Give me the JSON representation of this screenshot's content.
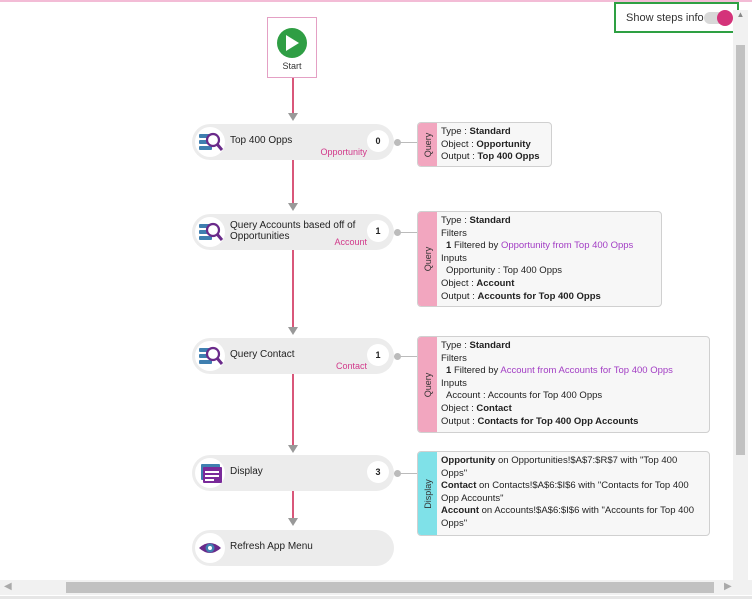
{
  "toggle": {
    "label": "Show steps info",
    "on": true
  },
  "start": {
    "label": "Start"
  },
  "steps": [
    {
      "title": "Top 400 Opps",
      "subtitle": "Opportunity",
      "count": "0",
      "icon": "database-search-icon"
    },
    {
      "title": "Query Accounts based off of Opportunities",
      "subtitle": "Account",
      "count": "1",
      "icon": "database-search-icon"
    },
    {
      "title": "Query Contact",
      "subtitle": "Contact",
      "count": "1",
      "icon": "database-search-icon"
    },
    {
      "title": "Display",
      "subtitle": "",
      "count": "3",
      "icon": "display-window-icon"
    },
    {
      "title": "Refresh App Menu",
      "subtitle": "",
      "count": "",
      "icon": "eye-icon"
    }
  ],
  "cards": {
    "c1": {
      "band": "Query",
      "type_k": "Type :",
      "type_v": "Standard",
      "object_k": "Object :",
      "object_v": "Opportunity",
      "output_k": "Output :",
      "output_v": "Top 400 Opps"
    },
    "c2": {
      "band": "Query",
      "type_k": "Type :",
      "type_v": "Standard",
      "filters": "Filters",
      "f_num": "1",
      "f_mid": "Filtered by",
      "f_link": "Opportunity from Top 400 Opps",
      "inputs": "Inputs",
      "input_line": "Opportunity : Top 400 Opps",
      "object_k": "Object :",
      "object_v": "Account",
      "output_k": "Output :",
      "output_v": "Accounts for Top 400 Opps"
    },
    "c3": {
      "band": "Query",
      "type_k": "Type :",
      "type_v": "Standard",
      "filters": "Filters",
      "f_num": "1",
      "f_mid": "Filtered by",
      "f_link": "Account from Accounts for Top 400 Opps",
      "inputs": "Inputs",
      "input_line": "Account : Accounts for Top 400 Opps",
      "object_k": "Object :",
      "object_v": "Contact",
      "output_k": "Output :",
      "output_v": "Contacts for Top 400 Opp Accounts"
    },
    "c4": {
      "band": "Display",
      "l1_b": "Opportunity",
      "l1_t": "on Opportunities!$A$7:$R$7 with  \"Top 400 Opps\"",
      "l2_b": "Contact",
      "l2_t": "on Contacts!$A$6:$I$6 with  \"Contacts for Top 400 Opp Accounts\"",
      "l3_b": "Account",
      "l3_t": "on Accounts!$A$6:$I$6 with  \"Accounts for Top 400 Opps\""
    }
  },
  "colors": {
    "accent": "#d1398a",
    "start_green": "#2f9e44",
    "query_band": "#f2a6bf",
    "display_band": "#7fe1e8",
    "highlight_border": "#2ea043"
  }
}
